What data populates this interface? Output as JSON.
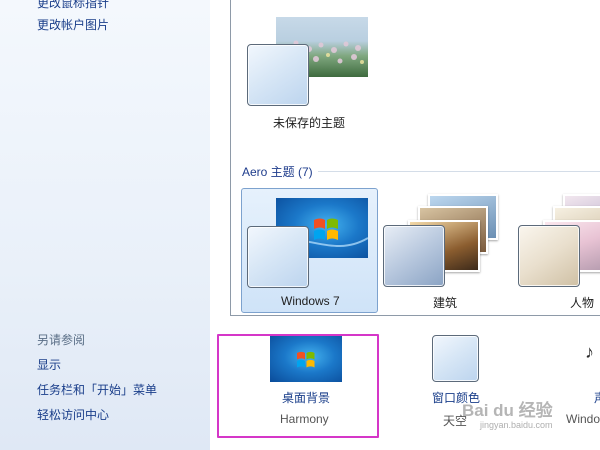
{
  "left_pane": {
    "top_links": [
      "更改鼠标指针",
      "更改帐户图片"
    ],
    "see_also_label": "另请参阅",
    "see_also_links": [
      "显示",
      "任务栏和「开始」菜单",
      "轻松访问中心"
    ]
  },
  "gallery": {
    "unsaved_theme_label": "未保存的主题",
    "aero_section_title": "Aero 主题 (7)",
    "aero_themes": [
      {
        "label": "Windows 7",
        "selected": true
      },
      {
        "label": "建筑",
        "selected": false
      },
      {
        "label": "人物",
        "selected": false
      }
    ]
  },
  "bottom_bar": {
    "items": [
      {
        "title": "桌面背景",
        "subtitle": "Harmony",
        "icon": "desktop-background-icon"
      },
      {
        "title": "窗口颜色",
        "subtitle": "天空",
        "icon": "window-color-icon"
      },
      {
        "title": "声",
        "subtitle": "Windo",
        "icon": "sound-icon"
      }
    ]
  },
  "watermark": {
    "text": "Bai du 经验",
    "sub": "jingyan.baidu.com"
  },
  "colors": {
    "link_blue": "#1a3e8a",
    "highlight_magenta": "#d536c8",
    "selection_blue": "#cfe3f8"
  }
}
